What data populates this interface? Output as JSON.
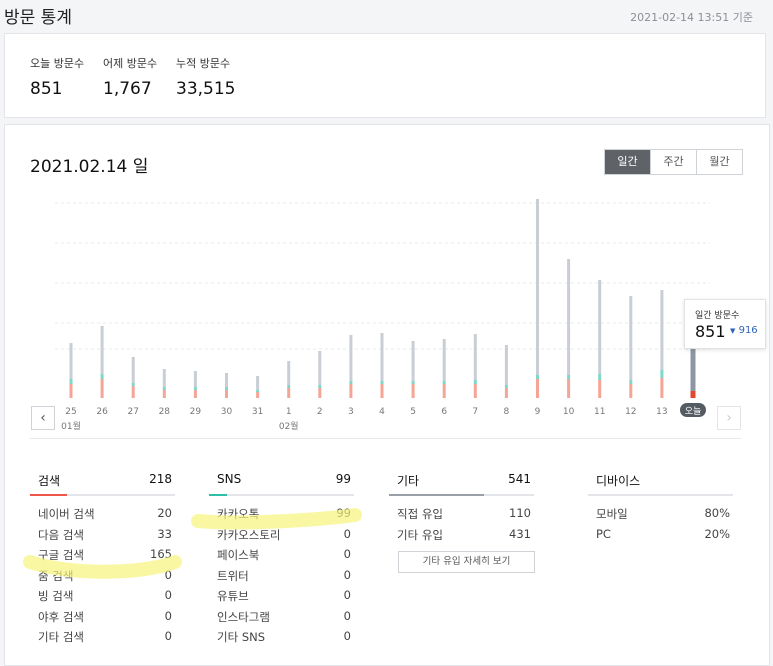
{
  "page": {
    "title": "방문 통계",
    "timestamp": "2021-02-14 13:51 기준"
  },
  "summary": [
    {
      "label": "오늘 방문수",
      "value": "851"
    },
    {
      "label": "어제 방문수",
      "value": "1,767"
    },
    {
      "label": "누적 방문수",
      "value": "33,515"
    }
  ],
  "chart": {
    "date_title": "2021.02.14 일",
    "periods": [
      {
        "label": "일간",
        "active": true
      },
      {
        "label": "주간",
        "active": false
      },
      {
        "label": "월간",
        "active": false
      }
    ],
    "prev_icon": "chevron-left-icon",
    "next_icon": "chevron-right-icon",
    "month_labels": [
      "01월",
      "02월"
    ],
    "tooltip": {
      "label": "일간 방문수",
      "value": "851",
      "prev_value": "916",
      "trend_icon": "triangle-down-icon"
    },
    "colors": {
      "gray": "#c8ced4",
      "teal": "#7dd8c9",
      "salmon": "#f5a596",
      "today_gray": "#8c97a3",
      "today_red": "#e5462f"
    }
  },
  "chart_data": {
    "type": "bar",
    "categories": [
      "25",
      "26",
      "27",
      "28",
      "29",
      "30",
      "31",
      "1",
      "2",
      "3",
      "4",
      "5",
      "6",
      "7",
      "8",
      "9",
      "10",
      "11",
      "12",
      "13",
      "오늘"
    ],
    "series": [
      {
        "values": [
          180,
          240,
          130,
          90,
          80,
          70,
          70,
          120,
          170,
          230,
          240,
          200,
          210,
          230,
          200,
          880,
          580,
          470,
          420,
          400,
          360
        ]
      },
      {
        "values": [
          25,
          25,
          15,
          15,
          15,
          15,
          10,
          15,
          15,
          15,
          15,
          15,
          15,
          20,
          15,
          20,
          20,
          30,
          20,
          40,
          0
        ]
      },
      {
        "values": [
          70,
          95,
          60,
          40,
          40,
          40,
          30,
          50,
          50,
          70,
          70,
          70,
          70,
          70,
          50,
          95,
          95,
          90,
          70,
          100,
          35
        ]
      }
    ]
  },
  "stats": {
    "search": {
      "title": "검색",
      "count": "218",
      "color": "#f0574a",
      "rows": [
        {
          "label": "네이버 검색",
          "value": "20"
        },
        {
          "label": "다음 검색",
          "value": "33"
        },
        {
          "label": "구글 검색",
          "value": "165"
        },
        {
          "label": "줌 검색",
          "value": "0"
        },
        {
          "label": "빙 검색",
          "value": "0"
        },
        {
          "label": "야후 검색",
          "value": "0"
        },
        {
          "label": "기타 검색",
          "value": "0"
        }
      ]
    },
    "sns": {
      "title": "SNS",
      "count": "99",
      "color": "#2cc1a7",
      "rows": [
        {
          "label": "카카오톡",
          "value": "99"
        },
        {
          "label": "카카오스토리",
          "value": "0"
        },
        {
          "label": "페이스북",
          "value": "0"
        },
        {
          "label": "트위터",
          "value": "0"
        },
        {
          "label": "유튜브",
          "value": "0"
        },
        {
          "label": "인스타그램",
          "value": "0"
        },
        {
          "label": "기타 SNS",
          "value": "0"
        }
      ]
    },
    "etc": {
      "title": "기타",
      "count": "541",
      "color": "#9aa0a8",
      "rows": [
        {
          "label": "직접 유입",
          "value": "110"
        },
        {
          "label": "기타 유입",
          "value": "431"
        }
      ],
      "button_label": "기타 유입 자세히 보기"
    },
    "device": {
      "title": "디바이스",
      "color": "#9aa0a8",
      "rows": [
        {
          "label": "모바일",
          "value": "80%"
        },
        {
          "label": "PC",
          "value": "20%"
        }
      ]
    }
  }
}
